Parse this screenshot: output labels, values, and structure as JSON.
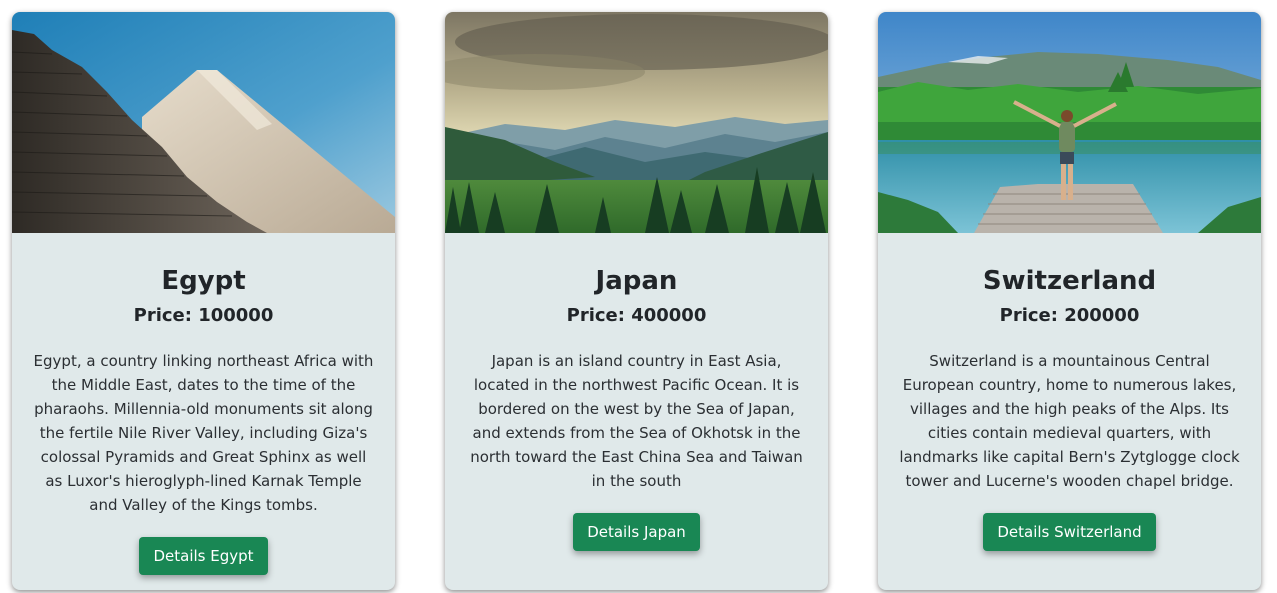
{
  "cards": [
    {
      "image": "pyramid-photo",
      "title": "Egypt",
      "price": "Price: 100000",
      "description": "Egypt, a country linking northeast Africa with the Middle East, dates to the time of the pharaohs. Millennia-old monuments sit along the fertile Nile River Valley, including Giza's colossal Pyramids and Great Sphinx as well as Luxor's hieroglyph-lined Karnak Temple and Valley of the Kings tombs.",
      "button": "Details Egypt"
    },
    {
      "image": "mountain-landscape-photo",
      "title": "Japan",
      "price": "Price: 400000",
      "description": "Japan is an island country in East Asia, located in the northwest Pacific Ocean. It is bordered on the west by the Sea of Japan, and extends from the Sea of Okhotsk in the north toward the East China Sea and Taiwan in the south",
      "button": "Details Japan"
    },
    {
      "image": "lake-pier-photo",
      "title": "Switzerland",
      "price": "Price: 200000",
      "description": "Switzerland is a mountainous Central European country, home to numerous lakes, villages and the high peaks of the Alps. Its cities contain medieval quarters, with landmarks like capital Bern's Zytglogge clock tower and Lucerne's wooden chapel bridge.",
      "button": "Details Switzerland"
    }
  ],
  "colors": {
    "card_background": "#e0e9ea",
    "button_background": "#198754",
    "button_text": "#ffffff"
  }
}
